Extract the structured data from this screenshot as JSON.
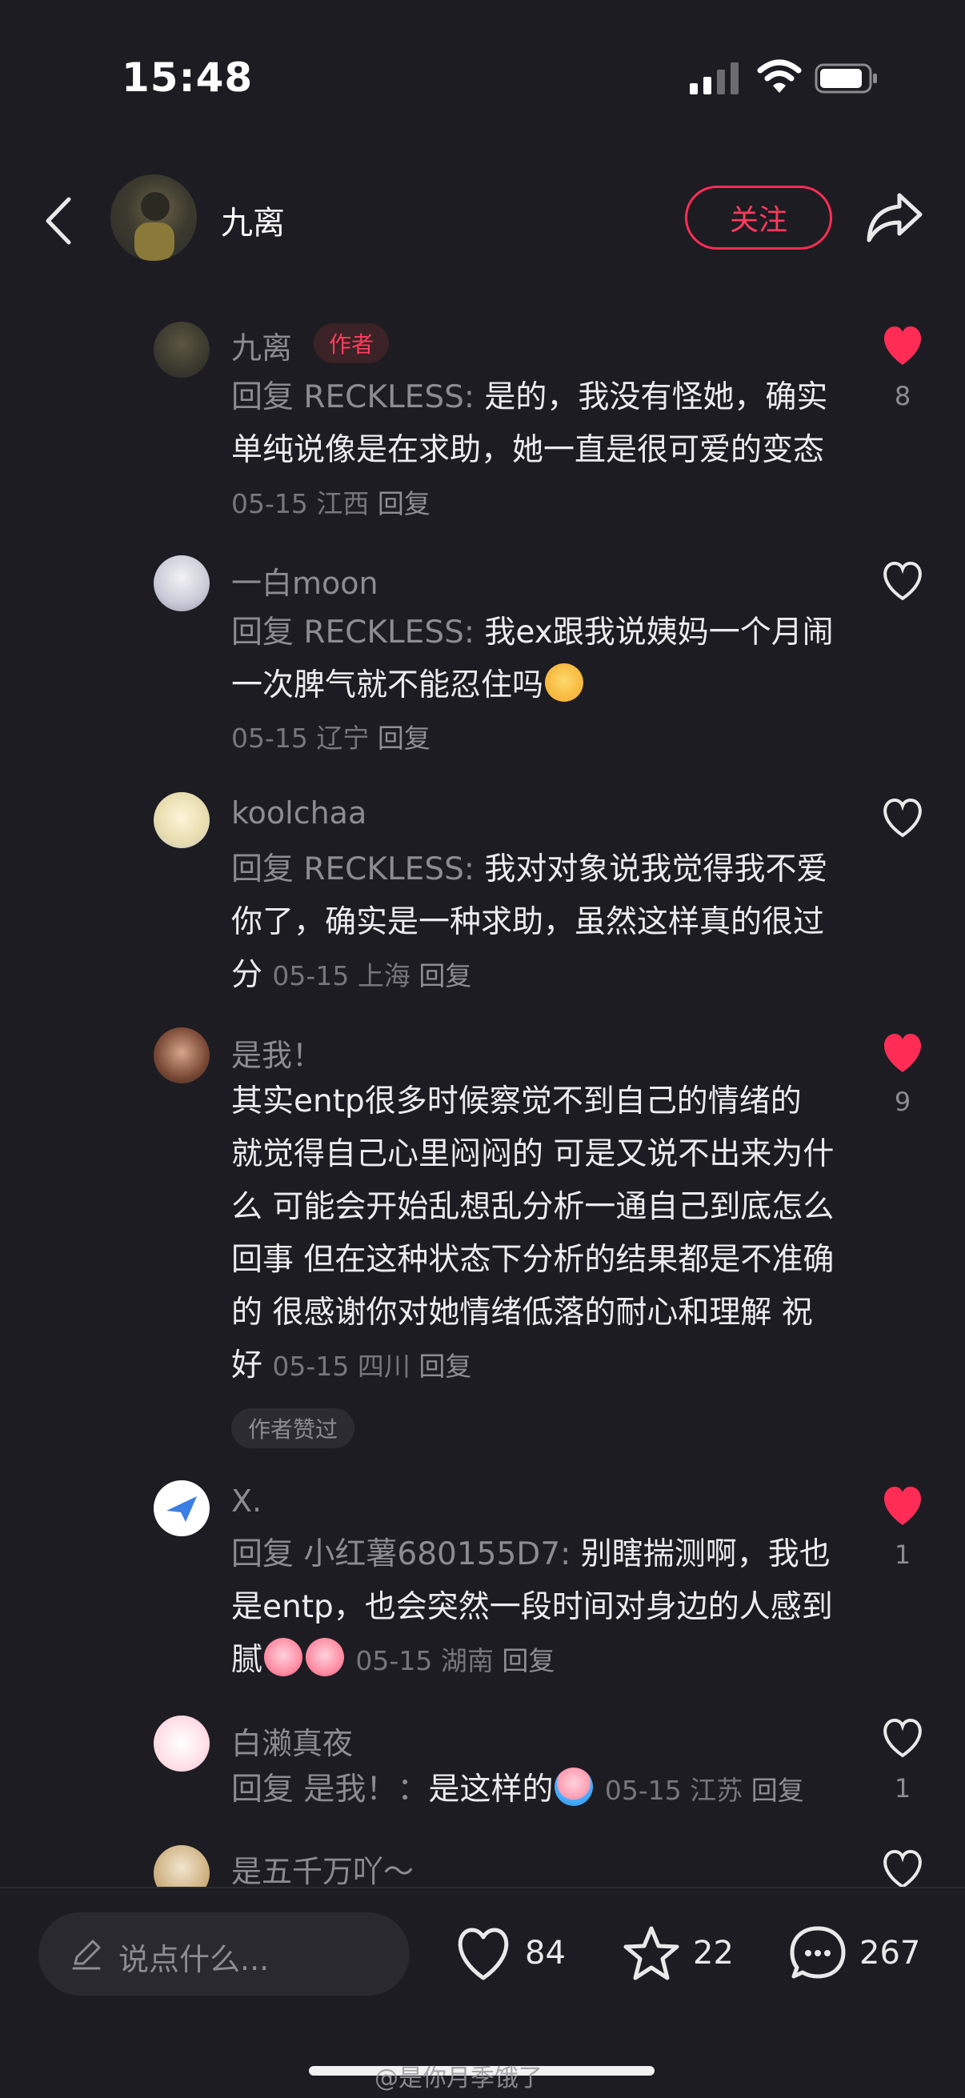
{
  "status_bar": {
    "time": "15:48"
  },
  "header": {
    "name": "九离",
    "follow_label": "关注"
  },
  "comments": [
    {
      "name": "九离",
      "author_tag": "作者",
      "reply_prefix": "回复 ",
      "reply_to": "RECKLESS",
      "reply_colon": ": ",
      "text": "是的，我没有怪她，确实单纯说像是在求助，她一直是很可爱的变态",
      "date": "05-15",
      "location": "江西",
      "reply_label": "回复",
      "liked": true,
      "likes": "8"
    },
    {
      "name": "一白moon",
      "reply_prefix": "回复 ",
      "reply_to": "RECKLESS",
      "reply_colon": ": ",
      "text": "我ex跟我说姨妈一个月闹一次脾气就不能忍住吗",
      "date": "05-15",
      "location": "辽宁",
      "reply_label": "回复",
      "liked": false,
      "likes": ""
    },
    {
      "name": "koolchaa",
      "reply_prefix": "回复 ",
      "reply_to": "RECKLESS",
      "reply_colon": ": ",
      "text": "我对对象说我觉得我不爱你了，确实是一种求助，虽然这样真的很过分",
      "date": "05-15",
      "location": "上海",
      "reply_label": "回复",
      "liked": false,
      "likes": ""
    },
    {
      "name": "是我！",
      "text": "其实entp很多时候察觉不到自己的情绪的 就觉得自己心里闷闷的 可是又说不出来为什么 可能会开始乱想乱分析一通自己到底怎么回事 但在这种状态下分析的结果都是不准确的  很感谢你对她情绪低落的耐心和理解 祝好",
      "date": "05-15",
      "location": "四川",
      "reply_label": "回复",
      "liked_by_author": "作者赞过",
      "liked": true,
      "likes": "9"
    },
    {
      "name": "X.",
      "reply_prefix": "回复 ",
      "reply_to": "小红薯680155D7",
      "reply_colon": ": ",
      "text": "别瞎揣测啊，我也是entp，也会突然一段时间对身边的人感到腻",
      "date": "05-15",
      "location": "湖南",
      "reply_label": "回复",
      "liked": true,
      "likes": "1"
    },
    {
      "name": "白濑真夜",
      "reply_prefix": "回复 ",
      "reply_to": "是我！",
      "reply_colon": "：",
      "text": "是这样的",
      "date": "05-15",
      "location": "江苏",
      "reply_label": "回复",
      "liked": false,
      "likes": "1"
    },
    {
      "name": "是五千万吖～",
      "liked": false,
      "likes": ""
    }
  ],
  "bottom_bar": {
    "input_placeholder": "说点什么...",
    "like_count": "84",
    "star_count": "22",
    "comment_count": "267"
  },
  "watermark": "@是你月季饿了",
  "colors": {
    "background": "#1d1c22",
    "accent": "#ff2d55"
  }
}
